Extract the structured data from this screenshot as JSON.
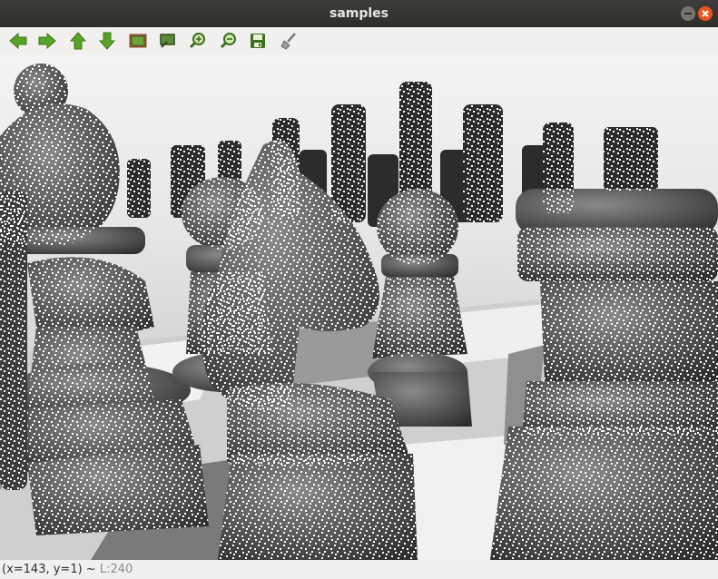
{
  "window": {
    "title": "samples"
  },
  "toolbar": {
    "buttons": [
      {
        "icon": "arrow-left-icon",
        "color": "#4e9a06"
      },
      {
        "icon": "arrow-right-icon",
        "color": "#4e9a06"
      },
      {
        "icon": "arrow-up-icon",
        "color": "#4e9a06"
      },
      {
        "icon": "arrow-down-icon",
        "color": "#4e9a06"
      },
      {
        "icon": "zoom-reset-icon"
      },
      {
        "icon": "zoom-fit-icon"
      },
      {
        "icon": "zoom-in-icon"
      },
      {
        "icon": "zoom-out-icon"
      },
      {
        "icon": "save-icon"
      },
      {
        "icon": "properties-icon"
      }
    ]
  },
  "status": {
    "coords": "(x=143, y=1) ~ ",
    "value": "L:240"
  }
}
